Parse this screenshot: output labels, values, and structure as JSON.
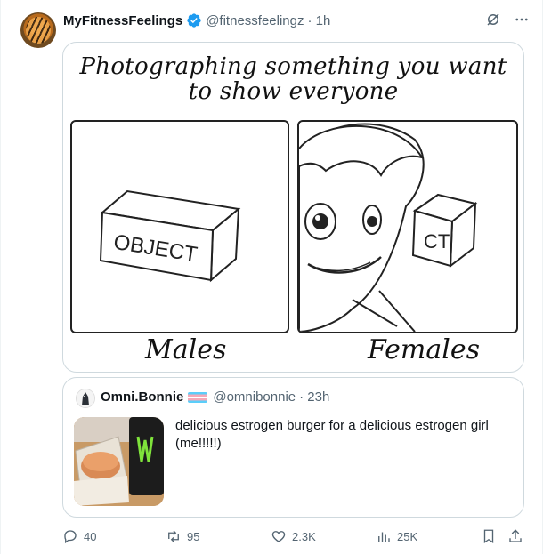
{
  "author": {
    "name": "MyFitnessFeelings",
    "handle": "@fitnessfeelingz",
    "time": "· 1h"
  },
  "top_icons": [
    "grok-icon",
    "more-icon"
  ],
  "meme": {
    "title_line1": "Photographing something you want",
    "title_line2": "to show everyone",
    "object_label": "OBJECT",
    "object_label_partial": "CT",
    "label_left": "Males",
    "label_right": "Females"
  },
  "quote": {
    "name": "Omni.Bonnie",
    "handle": "@omnibonnie",
    "time": "· 23h",
    "text": "delicious estrogen burger for a delicious estrogen girl (me!!!!!)"
  },
  "actions": {
    "replies": "40",
    "reposts": "95",
    "likes": "2.3K",
    "views": "25K"
  },
  "colors": {
    "text": "#0f1419",
    "muted": "#536471",
    "verified": "#1d9bf0",
    "border": "#cfd9de"
  }
}
